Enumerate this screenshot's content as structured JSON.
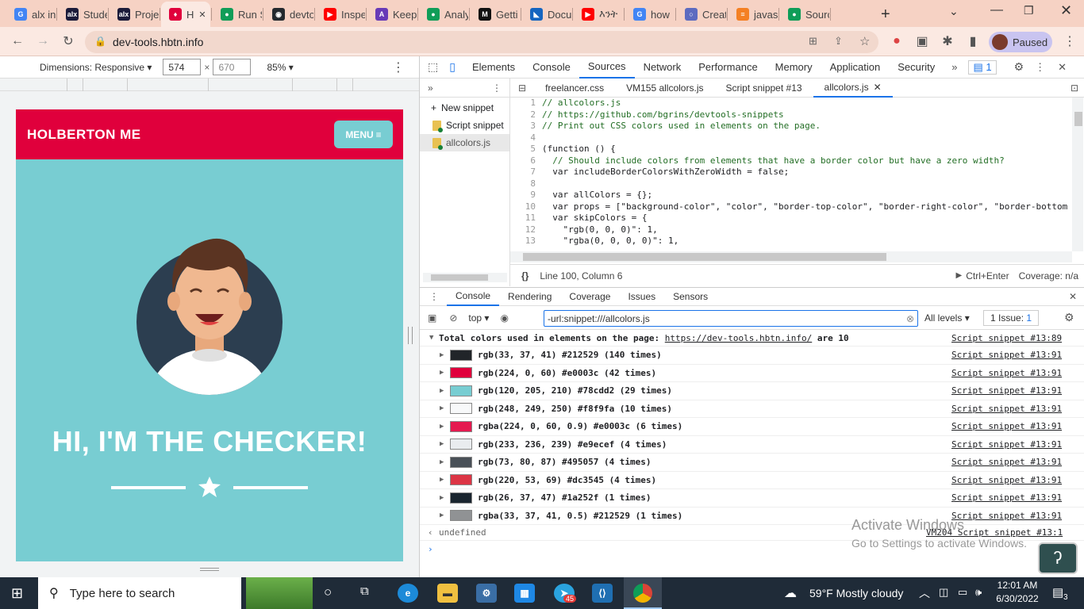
{
  "browser": {
    "tabs": [
      {
        "label": "alx in",
        "favicon": "G"
      },
      {
        "label": "Stude",
        "favicon": "alx"
      },
      {
        "label": "Proje",
        "favicon": "alx"
      },
      {
        "label": "H",
        "favicon": "H"
      },
      {
        "label": "Run S",
        "favicon": "C"
      },
      {
        "label": "devto",
        "favicon": "gh"
      },
      {
        "label": "Inspe",
        "favicon": "yt"
      },
      {
        "label": "Keep",
        "favicon": "A"
      },
      {
        "label": "Analy",
        "favicon": "C"
      },
      {
        "label": "Getti",
        "favicon": "M"
      },
      {
        "label": "Docu",
        "favicon": "vs"
      },
      {
        "label": "እንት",
        "favicon": "yt"
      },
      {
        "label": "how",
        "favicon": "G"
      },
      {
        "label": "Creat",
        "favicon": "o"
      },
      {
        "label": "javas",
        "favicon": "so"
      },
      {
        "label": "Sourc",
        "favicon": "C"
      }
    ],
    "url": "dev-tools.hbtn.info",
    "profile_label": "Paused"
  },
  "device": {
    "dimensions_label": "Dimensions: Responsive",
    "width": "574",
    "height": "670",
    "zoom": "85%"
  },
  "site": {
    "brand": "HOLBERTON ME",
    "menu_label": "MENU",
    "hero_title": "HI, I'M THE CHECKER!"
  },
  "devtools": {
    "tabs": [
      "Elements",
      "Console",
      "Sources",
      "Network",
      "Performance",
      "Memory",
      "Application",
      "Security"
    ],
    "active_tab": "Sources",
    "issues_badge": "1",
    "new_snippet": "New snippet",
    "snippets": [
      "Script snippet",
      "allcolors.js"
    ],
    "editor_tabs": [
      "freelancer.css",
      "VM155 allcolors.js",
      "Script snippet #13",
      "allcolors.js"
    ],
    "code_lines": [
      {
        "n": "1",
        "t": "// allcolors.js",
        "k": "cm"
      },
      {
        "n": "2",
        "t": "// https://github.com/bgrins/devtools-snippets",
        "k": "cm"
      },
      {
        "n": "3",
        "t": "// Print out CSS colors used in elements on the page.",
        "k": "cm"
      },
      {
        "n": "4",
        "t": "",
        "k": ""
      },
      {
        "n": "5",
        "t": "(function () {",
        "k": ""
      },
      {
        "n": "6",
        "t": "  // Should include colors from elements that have a border color but have a zero width?",
        "k": "cm"
      },
      {
        "n": "7",
        "t": "  var includeBorderColorsWithZeroWidth = false;",
        "k": ""
      },
      {
        "n": "8",
        "t": "",
        "k": ""
      },
      {
        "n": "9",
        "t": "  var allColors = {};",
        "k": ""
      },
      {
        "n": "10",
        "t": "  var props = [\"background-color\", \"color\", \"border-top-color\", \"border-right-color\", \"border-bottom",
        "k": ""
      },
      {
        "n": "11",
        "t": "  var skipColors = {",
        "k": ""
      },
      {
        "n": "12",
        "t": "    \"rgb(0, 0, 0)\": 1,",
        "k": ""
      },
      {
        "n": "13",
        "t": "    \"rgba(0, 0, 0, 0)\": 1,",
        "k": ""
      }
    ],
    "status_position": "Line 100, Column 6",
    "status_run": "Ctrl+Enter",
    "status_coverage": "Coverage: n/a",
    "drawer_tabs": [
      "Console",
      "Rendering",
      "Coverage",
      "Issues",
      "Sensors"
    ],
    "console_context": "top",
    "console_filter": "-url:snippet:///allcolors.js",
    "console_levels": "All levels",
    "console_issues": "1 Issue:",
    "console_issues_count": "1",
    "summary_text": "Total colors used in elements on the page:",
    "summary_link": "https://dev-tools.hbtn.info/",
    "summary_suffix": "are 10",
    "summary_source": "Script snippet #13:89",
    "colors": [
      {
        "text": "rgb(33, 37, 41) #212529 (140 times)",
        "swatch": "#212529",
        "src": "Script snippet #13:91"
      },
      {
        "text": "rgb(224, 0, 60) #e0003c (42 times)",
        "swatch": "#e0003c",
        "src": "Script snippet #13:91"
      },
      {
        "text": "rgb(120, 205, 210) #78cdd2 (29 times)",
        "swatch": "#78cdd2",
        "src": "Script snippet #13:91"
      },
      {
        "text": "rgb(248, 249, 250) #f8f9fa (10 times)",
        "swatch": "#f8f9fa",
        "src": "Script snippet #13:91"
      },
      {
        "text": "rgba(224, 0, 60, 0.9) #e0003c (6 times)",
        "swatch": "#e51a50",
        "src": "Script snippet #13:91"
      },
      {
        "text": "rgb(233, 236, 239) #e9ecef (4 times)",
        "swatch": "#e9ecef",
        "src": "Script snippet #13:91"
      },
      {
        "text": "rgb(73, 80, 87) #495057 (4 times)",
        "swatch": "#495057",
        "src": "Script snippet #13:91"
      },
      {
        "text": "rgb(220, 53, 69) #dc3545 (4 times)",
        "swatch": "#dc3545",
        "src": "Script snippet #13:91"
      },
      {
        "text": "rgb(26, 37, 47) #1a252f (1 times)",
        "swatch": "#1a252f",
        "src": "Script snippet #13:91"
      },
      {
        "text": "rgba(33, 37, 41, 0.5) #212529 (1 times)",
        "swatch": "#909294",
        "src": "Script snippet #13:91"
      }
    ],
    "undefined_text": "undefined",
    "undefined_src": "VM204 Script snippet #13:1"
  },
  "watermark": {
    "line1": "Activate Windows",
    "line2": "Go to Settings to activate Windows."
  },
  "taskbar": {
    "search_placeholder": "Type here to search",
    "weather": "59°F  Mostly cloudy",
    "time": "12:01 AM",
    "date": "6/30/2022",
    "notifications": "3",
    "telegram_badge": "45"
  },
  "colors": {
    "brand_red": "#e0003c",
    "brand_teal": "#78cdd2",
    "chrome_tab_bg": "#f6d2c4",
    "taskbar": "#1f2b38"
  }
}
